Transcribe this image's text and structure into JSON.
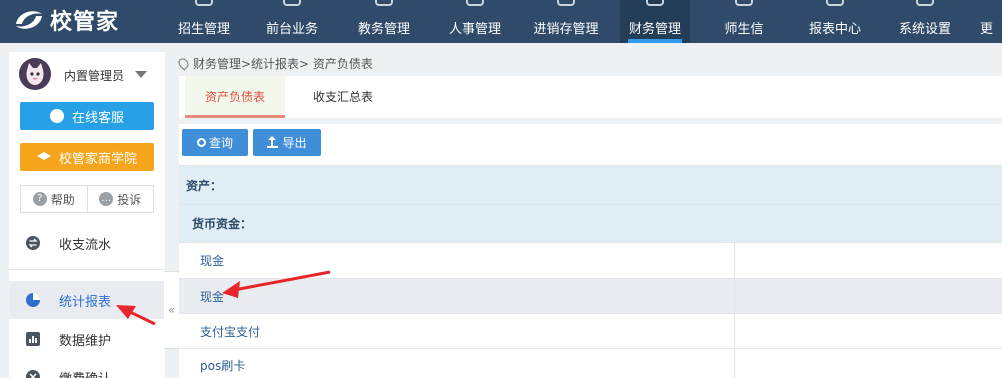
{
  "app": {
    "name": "校管家"
  },
  "nav": {
    "items": [
      {
        "label": "招生管理"
      },
      {
        "label": "前台业务"
      },
      {
        "label": "教务管理"
      },
      {
        "label": "人事管理"
      },
      {
        "label": "进销存管理"
      },
      {
        "label": "财务管理",
        "active": true
      },
      {
        "label": "师生信"
      },
      {
        "label": "报表中心"
      },
      {
        "label": "系统设置"
      },
      {
        "label": "更"
      }
    ]
  },
  "sidebar": {
    "user_name": "内置管理员",
    "service_button": "在线客服",
    "academy_button": "校管家商学院",
    "help": "帮助",
    "complain": "投诉",
    "items": [
      {
        "label": "收支流水"
      },
      {
        "label": "统计报表",
        "active": true
      },
      {
        "label": "数据维护"
      },
      {
        "label": "缴费确认"
      }
    ],
    "collapse_glyph": "«"
  },
  "breadcrumb": "财务管理>统计报表> 资产负债表",
  "tabs": [
    {
      "label": "资产负债表",
      "active": true
    },
    {
      "label": "收支汇总表"
    }
  ],
  "toolbar": {
    "query": "查询",
    "export": "导出"
  },
  "table": {
    "rows": [
      {
        "type": "group",
        "label": "资产："
      },
      {
        "type": "group",
        "label": "货币资金："
      },
      {
        "type": "item",
        "label": "现金"
      },
      {
        "type": "item",
        "label": "现金",
        "highlighted": true
      },
      {
        "type": "item",
        "label": "支付宝支付"
      },
      {
        "type": "item",
        "label": "pos刷卡"
      }
    ]
  },
  "colors": {
    "nav_bg": "#2f4b69",
    "accent_blue": "#27a0e6",
    "accent_orange": "#f5a51b",
    "tab_active": "#e0523e",
    "annotation_red": "#e8262a"
  }
}
